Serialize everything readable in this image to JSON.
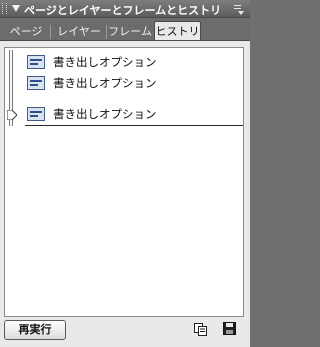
{
  "panel": {
    "title": "ページとレイヤーとフレームとヒストリ"
  },
  "tabs": [
    {
      "label": "ページ",
      "active": false
    },
    {
      "label": "レイヤー",
      "active": false
    },
    {
      "label": "フレーム",
      "active": false
    },
    {
      "label": "ヒストリ",
      "active": true
    }
  ],
  "history": {
    "items": [
      {
        "label": "書き出しオプション"
      },
      {
        "label": "書き出しオプション"
      },
      {
        "label": "書き出しオプション"
      }
    ],
    "current_step": 3
  },
  "footer": {
    "replay_label": "再実行"
  },
  "icons": {
    "collapse": "collapse-arrow-icon",
    "options": "panel-options-icon",
    "history_item": "history-step-icon",
    "copy": "copy-steps-icon",
    "save": "save-command-icon"
  },
  "colors": {
    "titlebar": "#6a6a6a",
    "panel_bg": "#e9e9e9",
    "list_bg": "#ffffff",
    "icon_blue": "#2c4f8f"
  }
}
